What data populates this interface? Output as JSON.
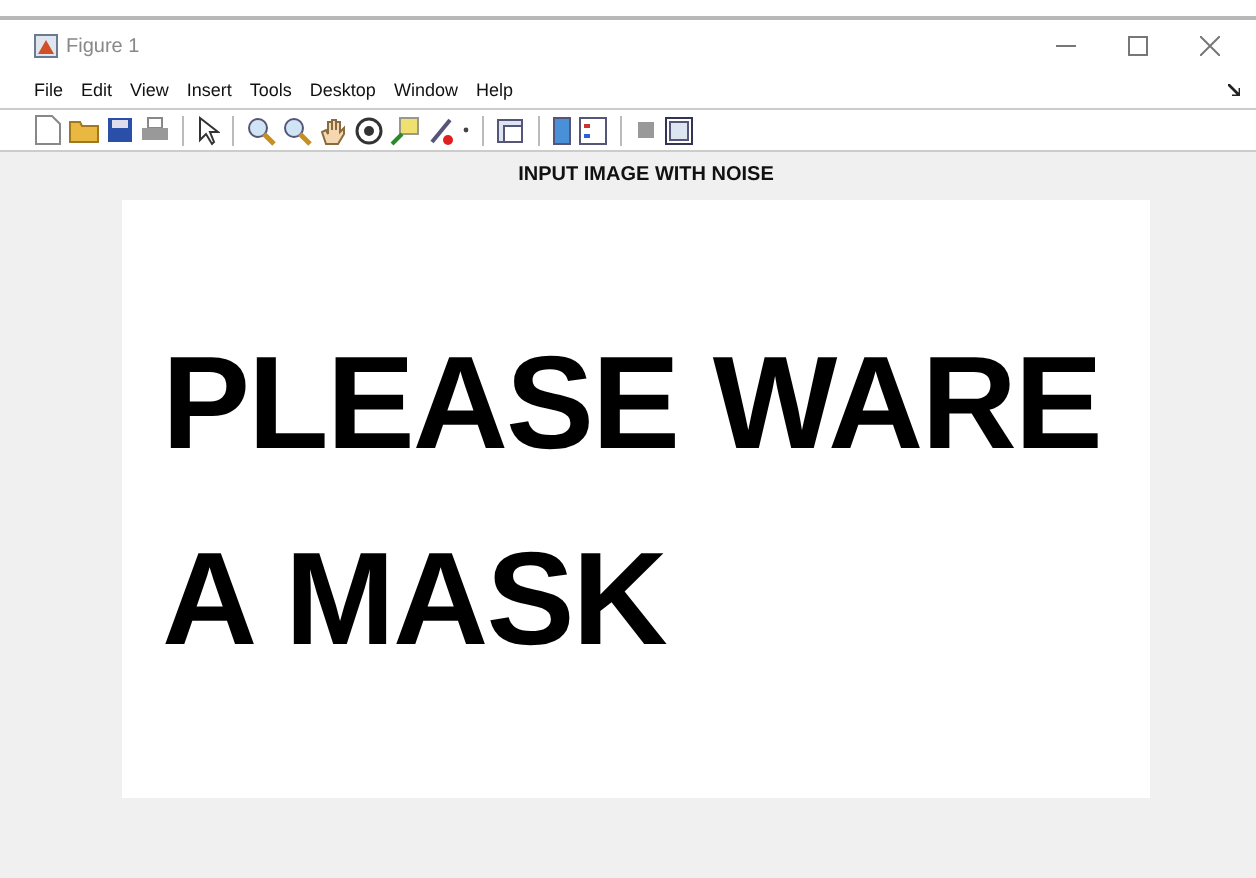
{
  "window": {
    "title": "Figure 1"
  },
  "menu": [
    "File",
    "Edit",
    "View",
    "Insert",
    "Tools",
    "Desktop",
    "Window",
    "Help"
  ],
  "axes": {
    "title": "INPUT IMAGE WITH NOISE",
    "image_lines": [
      "PLEASE WARE",
      "A MASK"
    ]
  }
}
